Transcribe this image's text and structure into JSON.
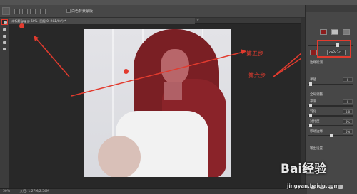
{
  "options_bar": {
    "checkbox_label": "白色背景蒙版"
  },
  "document": {
    "tab_title": "未标题.jpg @ 50% (图层 0, RGB/8#) *",
    "close_glyph": "×"
  },
  "annotations": {
    "step5": "第五步",
    "step6": "第六步",
    "color": "#e23b2e"
  },
  "panel": {
    "color_value": "ce2c3c",
    "rows": [
      {
        "label": "边缘检测"
      },
      {
        "label": "半径"
      },
      {
        "label": "全局调整"
      },
      {
        "label": "平滑"
      },
      {
        "label": "羽化"
      },
      {
        "label": "对比度"
      },
      {
        "label": "移动边缘"
      },
      {
        "label": "输出设置"
      }
    ],
    "values": [
      "0",
      "0",
      "0.0",
      "0%",
      "0%"
    ],
    "red_swatch": "#8b1d1d"
  },
  "statusbar": {
    "zoom": "50%",
    "doc_info": "文档: 1.27M/2.54M"
  },
  "watermark": {
    "text": "Bai经验",
    "url": "jingyan.baidu.com"
  },
  "icons": {
    "active_tool": "quick-selection-icon"
  }
}
